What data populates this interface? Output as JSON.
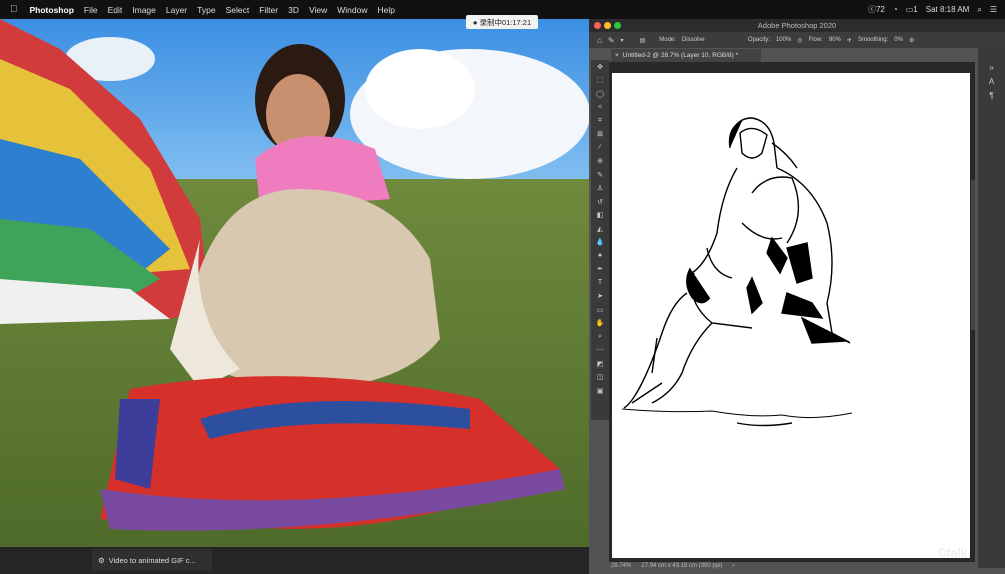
{
  "menubar": {
    "app_name": "Photoshop",
    "menus": [
      "File",
      "Edit",
      "Image",
      "Layer",
      "Type",
      "Select",
      "Filter",
      "3D",
      "View",
      "Window",
      "Help"
    ],
    "status_badge": "72",
    "battery": "1",
    "clock": "Sat 8:18 AM"
  },
  "recording": {
    "label": "● 录制中01:17:21"
  },
  "dock": {
    "gif_label": "Video to animated GIF c..."
  },
  "photoshop": {
    "window_title": "Adobe Photoshop 2020",
    "options": {
      "mode_label": "Mode:",
      "mode_value": "Dissolve",
      "opacity_label": "Opacity:",
      "opacity_value": "100%",
      "flow_label": "Flow:",
      "flow_value": "90%",
      "smoothing_label": "Smoothing:",
      "smoothing_value": "0%"
    },
    "doc_tab": "Untitled-2 @ 28.7% (Layer 10, RGB/8) *",
    "status": {
      "zoom": "28.74%",
      "dims": "27.94 cm x 43.18 cm (300 ppi)"
    }
  },
  "watermark": "Ctalk"
}
